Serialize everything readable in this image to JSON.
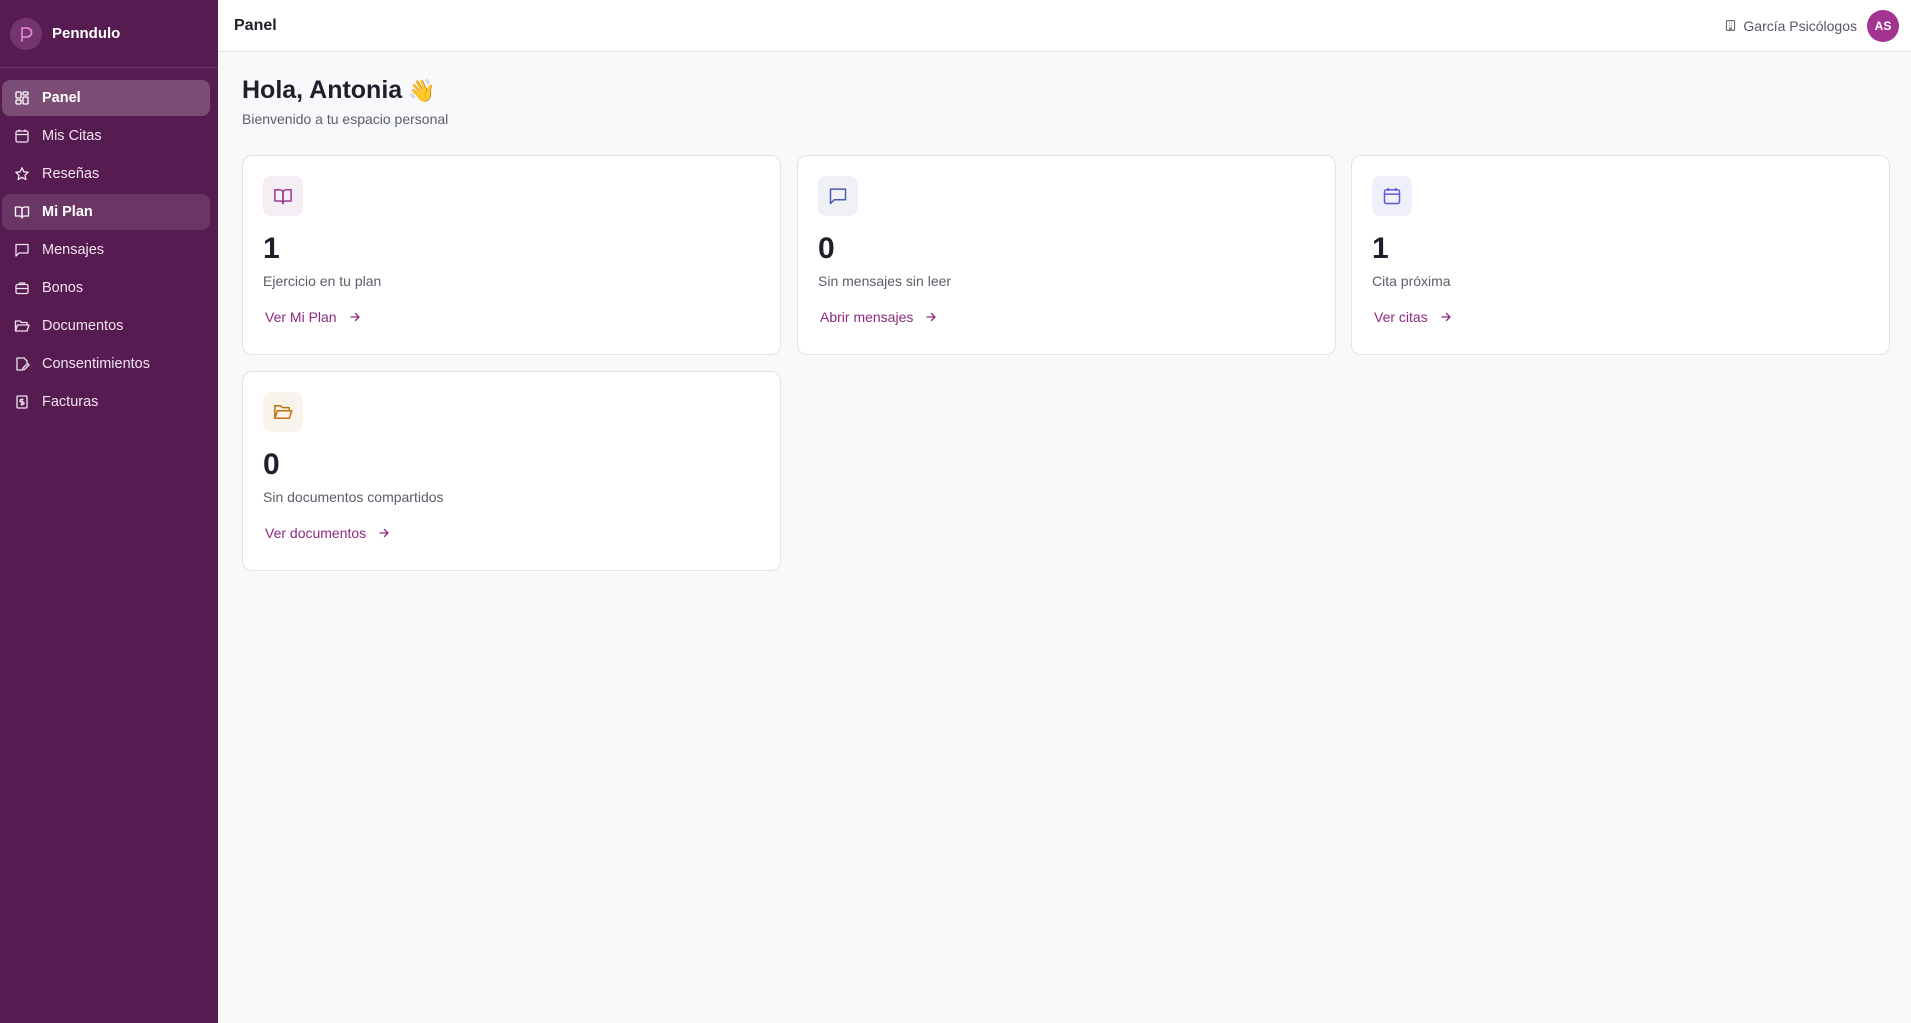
{
  "app": {
    "name": "Penndulo"
  },
  "sidebar": {
    "items": [
      {
        "label": "Panel",
        "icon": "dashboard-icon"
      },
      {
        "label": "Mis Citas",
        "icon": "calendar-icon"
      },
      {
        "label": "Reseñas",
        "icon": "star-icon"
      },
      {
        "label": "Mi Plan",
        "icon": "book-open-icon"
      },
      {
        "label": "Mensajes",
        "icon": "message-icon"
      },
      {
        "label": "Bonos",
        "icon": "briefcase-icon"
      },
      {
        "label": "Documentos",
        "icon": "folder-open-icon"
      },
      {
        "label": "Consentimientos",
        "icon": "file-signature-icon"
      },
      {
        "label": "Facturas",
        "icon": "receipt-icon"
      }
    ],
    "active_item": "Panel",
    "hovered_item": "Mi Plan"
  },
  "header": {
    "title": "Panel",
    "organization": "García Psicólogos",
    "avatar_initials": "AS"
  },
  "main": {
    "greeting": "Hola, Antonia",
    "greeting_emoji": "👋",
    "subtitle": "Bienvenido a tu espacio personal"
  },
  "cards": [
    {
      "value": "1",
      "description": "Ejercicio en tu plan",
      "link": "Ver Mi Plan",
      "icon": "book-open-icon",
      "accent": "#9b3a8c"
    },
    {
      "value": "0",
      "description": "Sin mensajes sin leer",
      "link": "Abrir mensajes",
      "icon": "message-icon",
      "accent": "#4b5bb0"
    },
    {
      "value": "1",
      "description": "Cita próxima",
      "link": "Ver citas",
      "icon": "calendar-icon",
      "accent": "#5b5bd6"
    },
    {
      "value": "0",
      "description": "Sin documentos compartidos",
      "link": "Ver documentos",
      "icon": "folder-open-icon",
      "accent": "#c2700a"
    }
  ],
  "colors": {
    "sidebar_bg": "#561b50",
    "accent": "#8e2a7f",
    "avatar_bg": "#a3348f"
  }
}
